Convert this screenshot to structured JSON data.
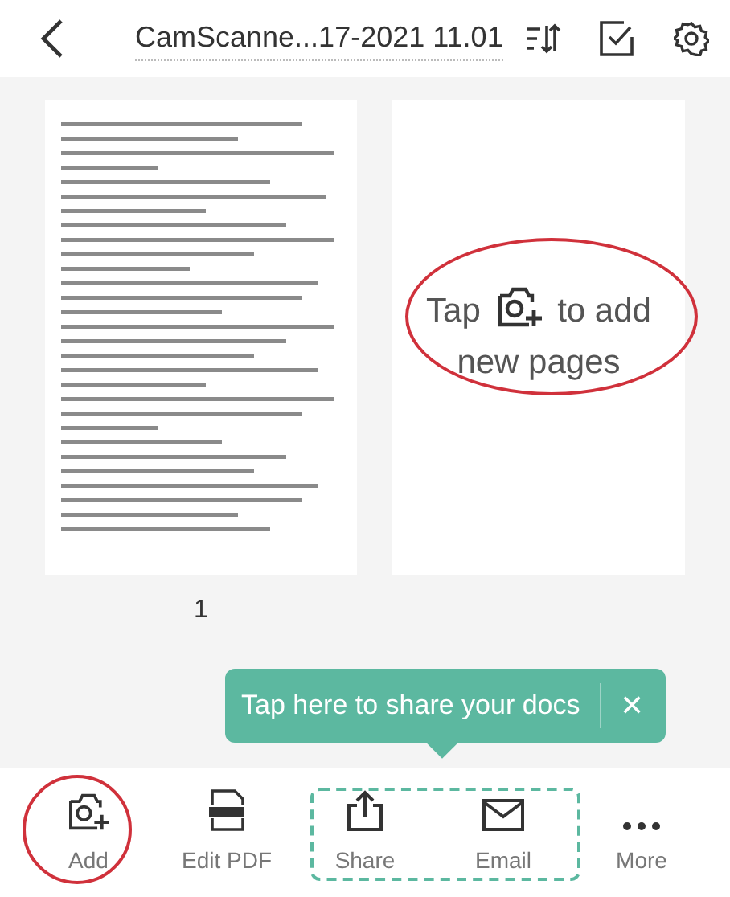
{
  "header": {
    "title": "CamScanne...17-2021 11.01"
  },
  "pages": [
    {
      "number": "1"
    }
  ],
  "add_card": {
    "before_icon": "Tap",
    "after_icon": "to add",
    "second_line": "new pages"
  },
  "tooltip": {
    "text": "Tap here to share your docs",
    "close": "✕"
  },
  "toolbar": [
    {
      "kind": "add",
      "label": "Add",
      "circled": true
    },
    {
      "kind": "pdf",
      "label": "Edit PDF",
      "circled": false
    },
    {
      "kind": "share",
      "label": "Share",
      "circled": false
    },
    {
      "kind": "email",
      "label": "Email",
      "circled": false
    },
    {
      "kind": "more",
      "label": "More",
      "circled": false
    }
  ]
}
